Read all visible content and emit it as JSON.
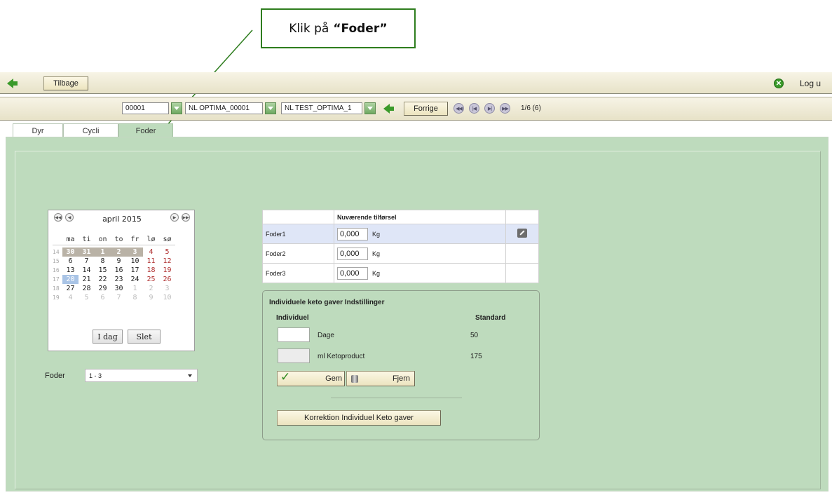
{
  "annotation": {
    "prefix": "Klik på",
    "target": "“Foder”"
  },
  "topbar": {
    "back_label": "Tilbage",
    "logout_label": "Log u"
  },
  "selectors": {
    "animal_id": "00001",
    "group": "NL OPTIMA_00001",
    "test": "NL TEST_OPTIMA_1",
    "prev_label": "Forrige",
    "counter": "1/6 (6)"
  },
  "tabs": [
    {
      "label": "Dyr",
      "active": false
    },
    {
      "label": "Cycli",
      "active": false
    },
    {
      "label": "Foder",
      "active": true
    }
  ],
  "calendar": {
    "month_title": "april 2015",
    "weekday_headers": [
      "ma",
      "ti",
      "on",
      "to",
      "fr",
      "lø",
      "sø"
    ],
    "weeks": [
      {
        "wk": "14",
        "days": [
          "30",
          "31",
          "1",
          "2",
          "3",
          "4",
          "5"
        ]
      },
      {
        "wk": "15",
        "days": [
          "6",
          "7",
          "8",
          "9",
          "10",
          "11",
          "12"
        ]
      },
      {
        "wk": "16",
        "days": [
          "13",
          "14",
          "15",
          "16",
          "17",
          "18",
          "19"
        ]
      },
      {
        "wk": "17",
        "days": [
          "20",
          "21",
          "22",
          "23",
          "24",
          "25",
          "26"
        ]
      },
      {
        "wk": "18",
        "days": [
          "27",
          "28",
          "29",
          "30",
          "1",
          "2",
          "3"
        ]
      },
      {
        "wk": "19",
        "days": [
          "4",
          "5",
          "6",
          "7",
          "8",
          "9",
          "10"
        ]
      }
    ],
    "today_label": "I dag",
    "clear_label": "Slet"
  },
  "foder_filter": {
    "label": "Foder",
    "value": "1 - 3"
  },
  "feed_table": {
    "header": "Nuværende tilførsel",
    "unit": "Kg",
    "rows": [
      {
        "name": "Foder1",
        "value": "0,000"
      },
      {
        "name": "Foder2",
        "value": "0,000"
      },
      {
        "name": "Foder3",
        "value": "0,000"
      }
    ]
  },
  "keto": {
    "title": "Individuele keto gaver Indstillinger",
    "col_individual": "Individuel",
    "col_standard": "Standard",
    "rows": [
      {
        "label": "Dage",
        "standard": "50"
      },
      {
        "label": "ml Ketoproduct",
        "standard": "175"
      }
    ],
    "save_label": "Gem",
    "remove_label": "Fjern",
    "correction_label": "Korrektion Individuel Keto gaver"
  },
  "colors": {
    "panel": "#bedbbd",
    "toolbar": "#ece7cf",
    "accent_green": "#3a9a2a"
  }
}
